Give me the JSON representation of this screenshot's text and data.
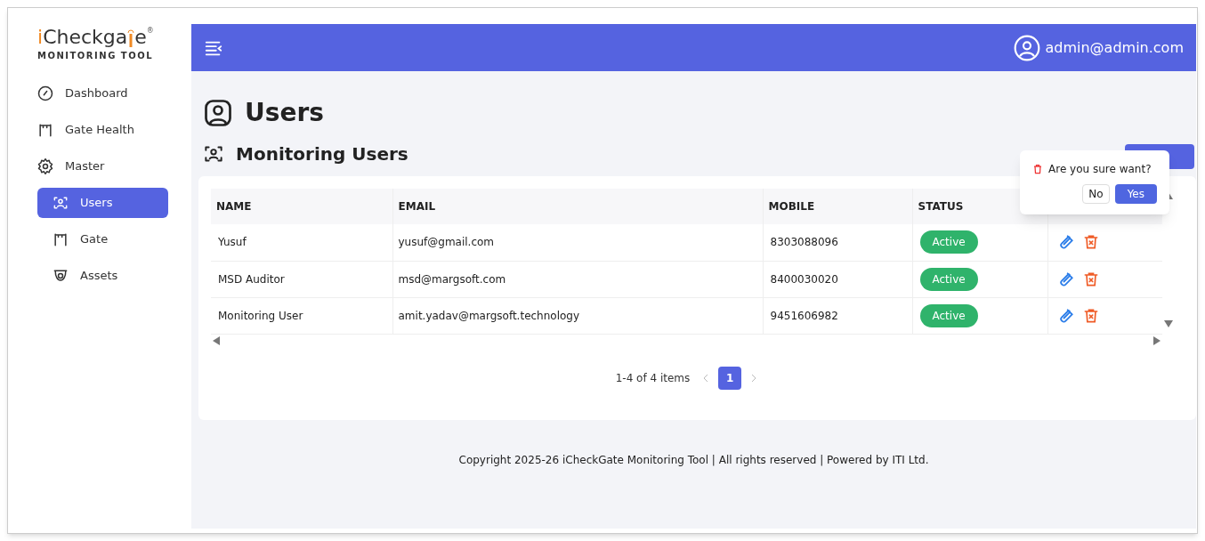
{
  "logo": {
    "first": "i",
    "main": "Checkga",
    "last": "e",
    "reg": "®",
    "subtitle": "MONITORING TOOL"
  },
  "sidebar": {
    "items": [
      {
        "label": "Dashboard",
        "kind": "gauge",
        "selected": false
      },
      {
        "label": "Gate Health",
        "kind": "gate",
        "selected": false
      },
      {
        "label": "Master",
        "kind": "gear",
        "selected": false,
        "children": [
          {
            "label": "Users",
            "kind": "user-scan",
            "selected": true
          },
          {
            "label": "Gate",
            "kind": "gate",
            "selected": false
          },
          {
            "label": "Assets",
            "kind": "camera",
            "selected": false
          }
        ]
      }
    ]
  },
  "header": {
    "user": "admin@admin.com"
  },
  "page": {
    "title": "Users",
    "subtitle": "Monitoring Users"
  },
  "table": {
    "columns": [
      "NAME",
      "EMAIL",
      "MOBILE",
      "STATUS"
    ],
    "rows": [
      {
        "name": "Yusuf",
        "email": "yusuf@gmail.com",
        "mobile": "8303088096",
        "status": "Active"
      },
      {
        "name": "MSD Auditor",
        "email": "msd@margsoft.com",
        "mobile": "8400030020",
        "status": "Active"
      },
      {
        "name": "Monitoring User",
        "email": "amit.yadav@margsoft.technology",
        "mobile": "9451606982",
        "status": "Active"
      }
    ]
  },
  "pagination": {
    "summary": "1-4 of 4 items",
    "pages": [
      {
        "label": "1",
        "selected": true
      }
    ]
  },
  "popconfirm": {
    "message": "Are you sure want?",
    "cancel": "No",
    "confirm": "Yes"
  },
  "footer": "Copyright 2025-26 iCheckGate Monitoring Tool | All rights reserved | Powered by ITI Ltd."
}
